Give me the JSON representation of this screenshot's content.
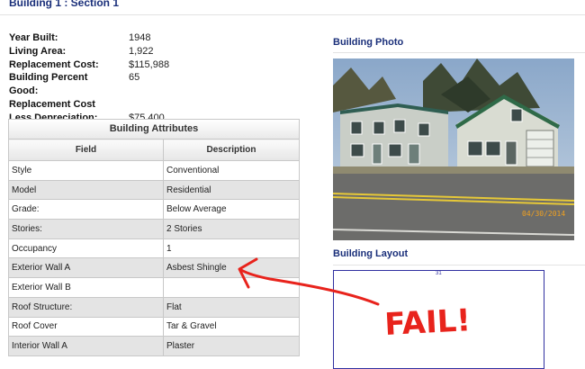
{
  "header": {
    "title": "Building 1 : Section 1"
  },
  "summary": {
    "year_built_label": "Year Built:",
    "year_built": "1948",
    "living_area_label": "Living Area:",
    "living_area": "1,922",
    "replacement_cost_label": "Replacement Cost:",
    "replacement_cost": "$115,988",
    "building_percent_label": "Building Percent",
    "building_percent": "65",
    "good_label": "Good:",
    "rcld_label_1": "Replacement Cost",
    "rcld_label_2": "Less Depreciation:",
    "rcld": "$75,400"
  },
  "attributes": {
    "caption": "Building Attributes",
    "headers": {
      "field": "Field",
      "description": "Description"
    },
    "rows": [
      {
        "field": "Style",
        "description": "Conventional"
      },
      {
        "field": "Model",
        "description": "Residential"
      },
      {
        "field": "Grade:",
        "description": "Below Average"
      },
      {
        "field": "Stories:",
        "description": "2 Stories"
      },
      {
        "field": "Occupancy",
        "description": "1"
      },
      {
        "field": "Exterior Wall A",
        "description": "Asbest Shingle"
      },
      {
        "field": "Exterior Wall B",
        "description": ""
      },
      {
        "field": "Roof Structure:",
        "description": "Flat"
      },
      {
        "field": "Roof Cover",
        "description": "Tar & Gravel"
      },
      {
        "field": "Interior Wall A",
        "description": "Plaster"
      }
    ]
  },
  "photo": {
    "heading": "Building Photo",
    "date_stamp": "04/30/2014"
  },
  "layout": {
    "heading": "Building Layout",
    "dimension": "31"
  },
  "annotation": {
    "text": "FAIL!",
    "color": "#e8231c"
  },
  "colors": {
    "heading": "#1a2f7a",
    "row_alt": "#e4e4e4",
    "layout_line": "#3030a0"
  }
}
